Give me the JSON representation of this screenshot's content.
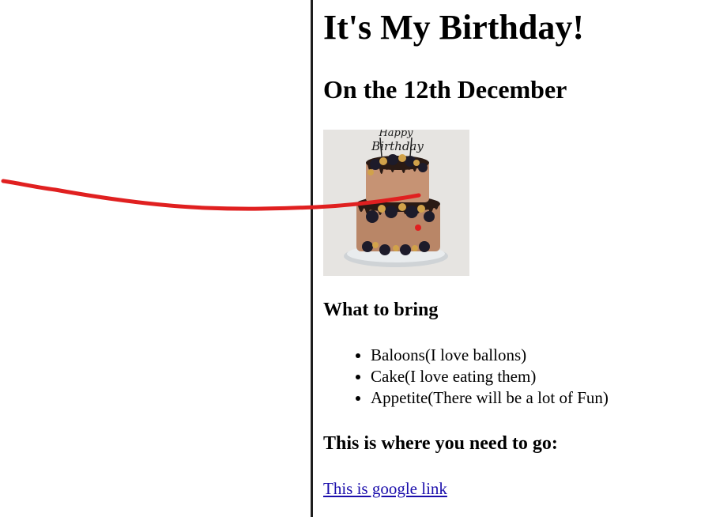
{
  "page": {
    "title": "It's My Birthday!",
    "subtitle": "On the 12th December"
  },
  "image": {
    "icon": "birthday-cake-image",
    "topper_text": "Happy Birthday"
  },
  "bring_section": {
    "heading": "What to bring",
    "items": [
      "Baloons(I love ballons)",
      "Cake(I love eating them)",
      "Appetite(There will be a lot of Fun)"
    ]
  },
  "location_section": {
    "heading": "This is where you need to go:",
    "link_text": "This is google link"
  },
  "colors": {
    "link": "#1a0dab",
    "annotation_stroke": "#e02020",
    "divider": "#1d1d1d"
  }
}
